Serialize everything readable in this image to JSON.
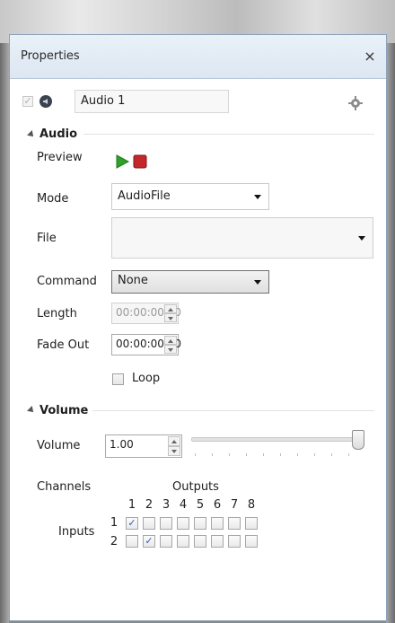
{
  "window": {
    "title": "Properties",
    "close_label": "×"
  },
  "header": {
    "enabled_checked": true,
    "name_value": "Audio 1"
  },
  "audio_section": {
    "title": "Audio",
    "preview_label": "Preview",
    "mode_label": "Mode",
    "mode_value": "AudioFile",
    "file_label": "File",
    "file_value": "",
    "command_label": "Command",
    "command_value": "None",
    "length_label": "Length",
    "length_value": "00:00:00.00",
    "fadeout_label": "Fade Out",
    "fadeout_value": "00:00:00.00",
    "loop_label": "Loop",
    "loop_checked": false
  },
  "volume_section": {
    "title": "Volume",
    "volume_label": "Volume",
    "volume_value": "1.00",
    "slider_value_fraction": 1.0,
    "channels_label": "Channels",
    "outputs_label": "Outputs",
    "inputs_label": "Inputs",
    "output_numbers": [
      "1",
      "2",
      "3",
      "4",
      "5",
      "6",
      "7",
      "8"
    ],
    "input_numbers": [
      "1",
      "2"
    ],
    "matrix": [
      [
        true,
        false,
        false,
        false,
        false,
        false,
        false,
        false
      ],
      [
        false,
        true,
        false,
        false,
        false,
        false,
        false,
        false
      ]
    ]
  },
  "icons": {
    "media": "speaker-icon",
    "settings": "gear-icon",
    "play": "play-icon",
    "stop": "stop-icon"
  },
  "colors": {
    "play": "#2fa12b",
    "stop": "#c3262b",
    "accent": "#2f5fb3"
  }
}
